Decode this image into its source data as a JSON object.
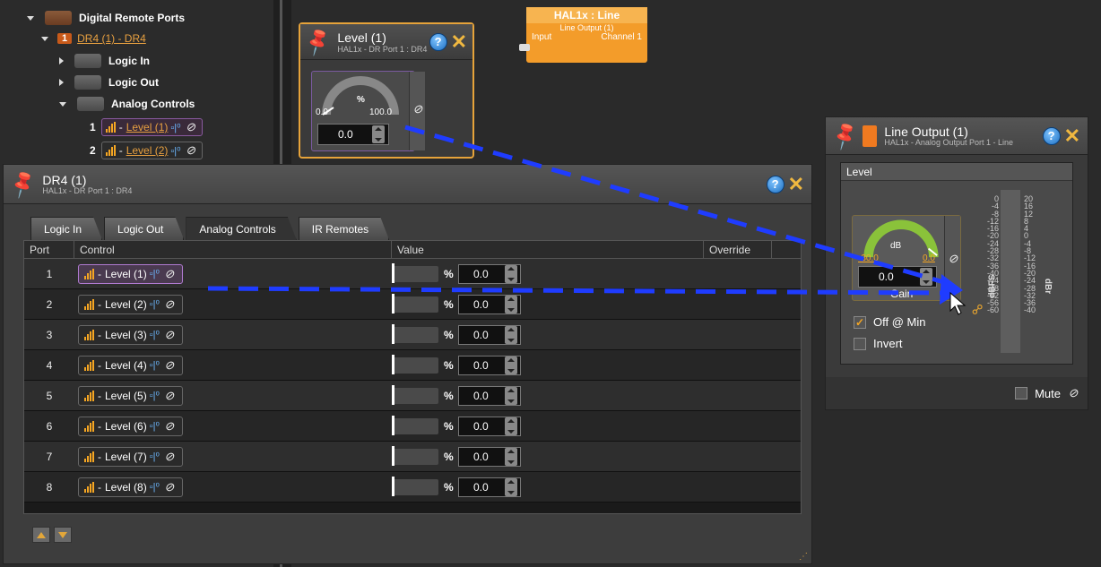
{
  "tree": {
    "root_label": "Digital Remote Ports",
    "device_num": "1",
    "device_label": "DR4 (1) - DR4",
    "logic_in": "Logic In",
    "logic_out": "Logic Out",
    "analog_controls": "Analog Controls",
    "items": [
      {
        "num": "1",
        "label": "Level (1)",
        "sep": "-"
      },
      {
        "num": "2",
        "label": "Level (2)",
        "sep": "-"
      }
    ]
  },
  "node_level": {
    "title": "Level (1)",
    "subtitle": "HAL1x - DR Port 1 : DR4",
    "unit": "%",
    "min": "0.0",
    "max": "100.0",
    "value": "0.0"
  },
  "node_hal": {
    "title": "HAL1x : Line",
    "subtitle": "Line Output (1)",
    "input_label": "Input",
    "channel_label": "Channel 1"
  },
  "dr4": {
    "title": "DR4 (1)",
    "subtitle": "HAL1x - DR Port 1 : DR4",
    "tabs": [
      "Logic In",
      "Logic Out",
      "Analog Controls",
      "IR Remotes"
    ],
    "active_tab": "Analog Controls",
    "columns": {
      "port": "Port",
      "control": "Control",
      "value": "Value",
      "override": "Override"
    },
    "rows": [
      {
        "port": "1",
        "control": "Level (1)",
        "pct": "%",
        "value": "0.0"
      },
      {
        "port": "2",
        "control": "Level (2)",
        "pct": "%",
        "value": "0.0"
      },
      {
        "port": "3",
        "control": "Level (3)",
        "pct": "%",
        "value": "0.0"
      },
      {
        "port": "4",
        "control": "Level (4)",
        "pct": "%",
        "value": "0.0"
      },
      {
        "port": "5",
        "control": "Level (5)",
        "pct": "%",
        "value": "0.0"
      },
      {
        "port": "6",
        "control": "Level (6)",
        "pct": "%",
        "value": "0.0"
      },
      {
        "port": "7",
        "control": "Level (7)",
        "pct": "%",
        "value": "0.0"
      },
      {
        "port": "8",
        "control": "Level (8)",
        "pct": "%",
        "value": "0.0"
      }
    ],
    "row_sep": "-"
  },
  "line_output": {
    "title": "Line Output (1)",
    "subtitle": "HAL1x - Analog Output Port 1 - Line",
    "section": "Level",
    "gain_unit": "dB",
    "gain_min": "-30.0",
    "gain_max": "0.0",
    "gain_value": "0.0",
    "gain_label": "Gain",
    "off_at_min": "Off @ Min",
    "invert": "Invert",
    "mute": "Mute",
    "dbfs_label": "dBFS",
    "dbr_label": "dBr",
    "dbfs_scale": "0\n-4\n-8\n-12\n-16\n-20\n-24\n-28\n-32\n-36\n-40\n-44\n-48\n-52\n-56\n-60",
    "dbr_scale": "20\n16\n12\n8\n4\n0\n-4\n-8\n-12\n-16\n-20\n-24\n-28\n-32\n-36\n-40",
    "off_at_min_checked": true,
    "invert_checked": false
  },
  "icons": {
    "help": "?",
    "close": "✕",
    "link": "🔗"
  },
  "colors": {
    "accent_orange": "#f39c2a",
    "selection_purple": "#b07ad0",
    "connector_blue": "#1f3cff"
  }
}
